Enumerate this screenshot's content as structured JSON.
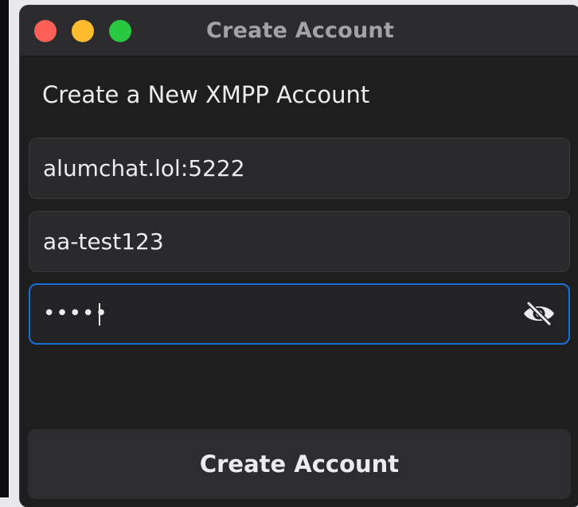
{
  "window": {
    "title": "Create Account"
  },
  "form": {
    "heading": "Create a New XMPP Account",
    "server": {
      "value": "alumchat.lol:5222"
    },
    "username": {
      "value": "aa-test123"
    },
    "password": {
      "masked_value": "•••••",
      "visibility_icon": "eye-slash-icon"
    }
  },
  "actions": {
    "create_label": "Create Account"
  },
  "colors": {
    "close": "#fe5f57",
    "minimize": "#febc2e",
    "zoom": "#28c840",
    "focus_border": "#1a6fd6"
  }
}
